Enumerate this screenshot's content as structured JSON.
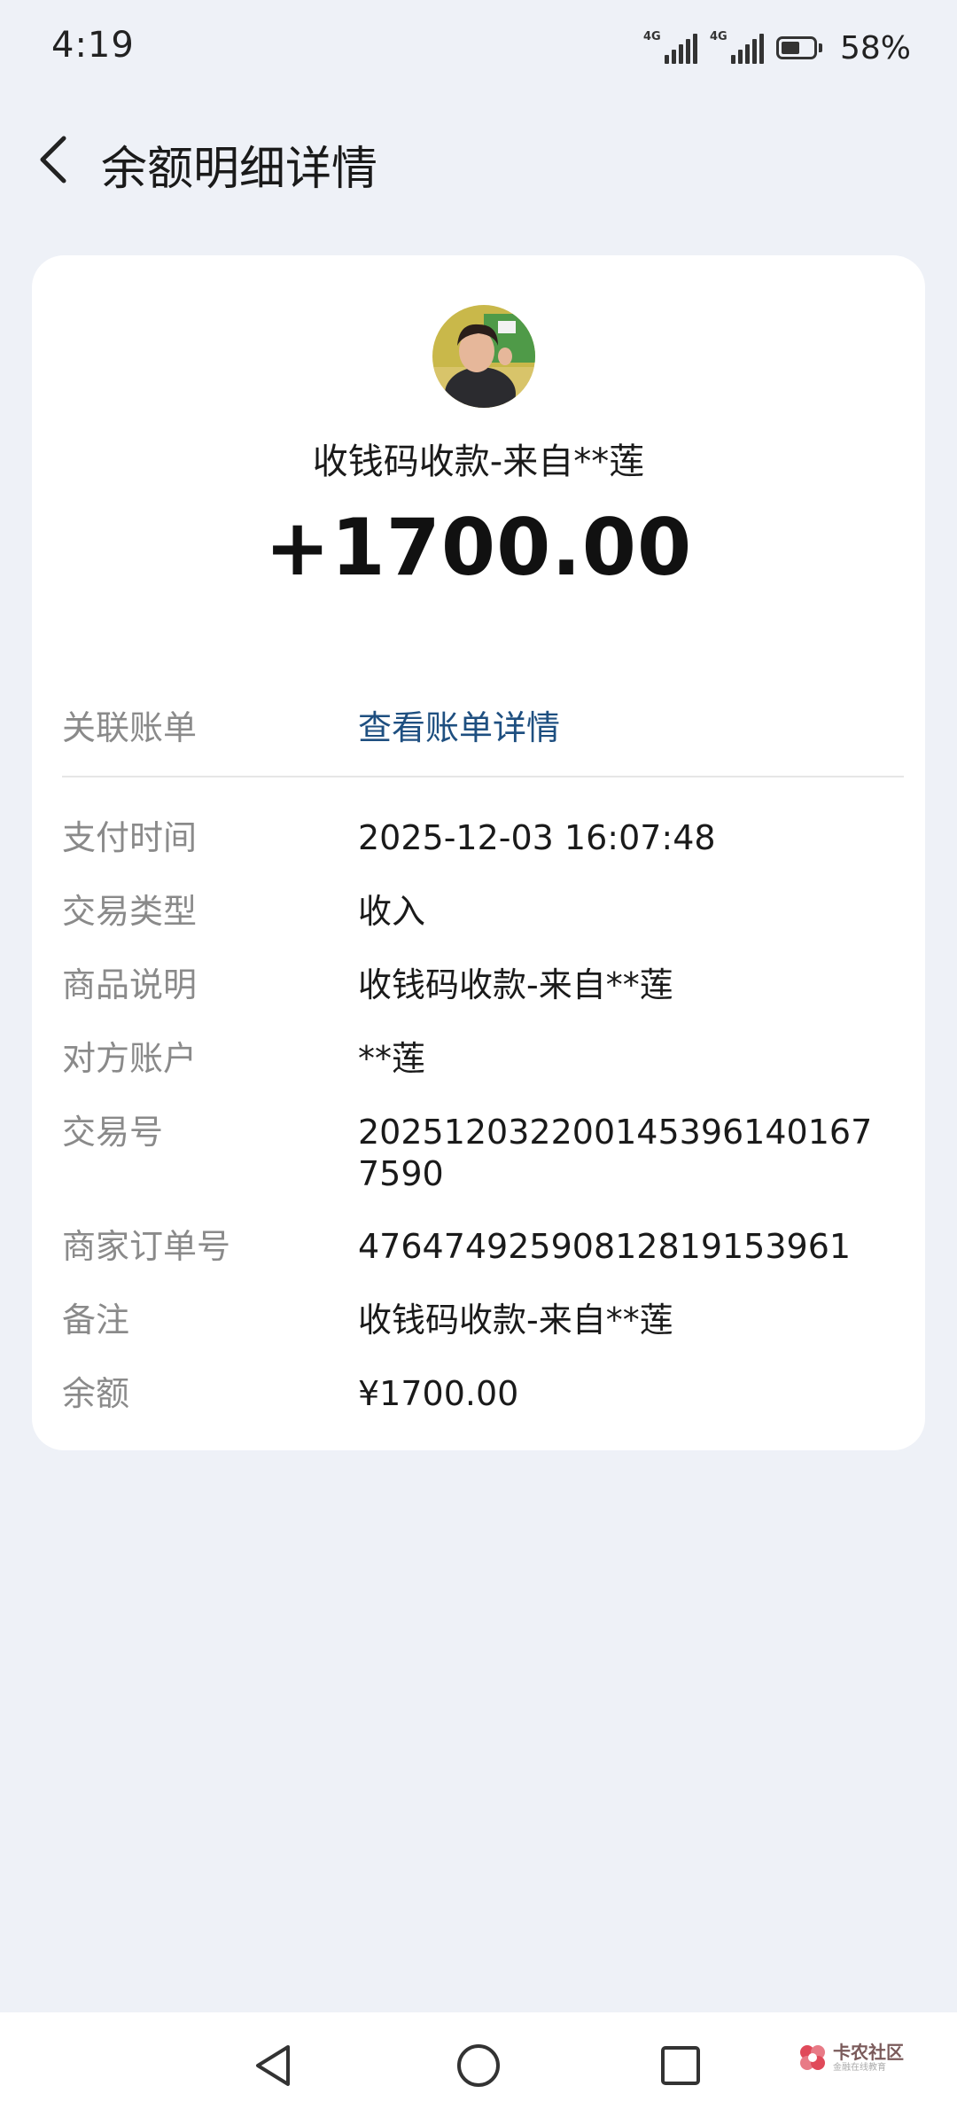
{
  "status_bar": {
    "time": "4:19",
    "signal1_label": "4G",
    "signal2_label": "4G",
    "battery_percent": "58%"
  },
  "header": {
    "title": "余额明细详情"
  },
  "summary": {
    "title": "收钱码收款-来自**莲",
    "amount": "+1700.00"
  },
  "details": {
    "linked_bill_label": "关联账单",
    "linked_bill_value": "查看账单详情",
    "rows": [
      {
        "label": "支付时间",
        "value": "2025-12-03 16:07:48"
      },
      {
        "label": "交易类型",
        "value": "收入"
      },
      {
        "label": "商品说明",
        "value": "收钱码收款-来自**莲"
      },
      {
        "label": "对方账户",
        "value": "**莲"
      },
      {
        "label": "交易号",
        "value": "2025120322001453961401677590"
      },
      {
        "label": "商家订单号",
        "value": "4764749259081281915396​1"
      },
      {
        "label": "备注",
        "value": "收钱码收款-来自**莲"
      },
      {
        "label": "余额",
        "value": "¥1700.00"
      }
    ]
  },
  "watermark": {
    "main": "卡农社区",
    "sub": "金融在线教育"
  },
  "colors": {
    "background": "#eef1f7",
    "card": "#ffffff",
    "label": "#8a8a8a",
    "link": "#1e4f80"
  }
}
